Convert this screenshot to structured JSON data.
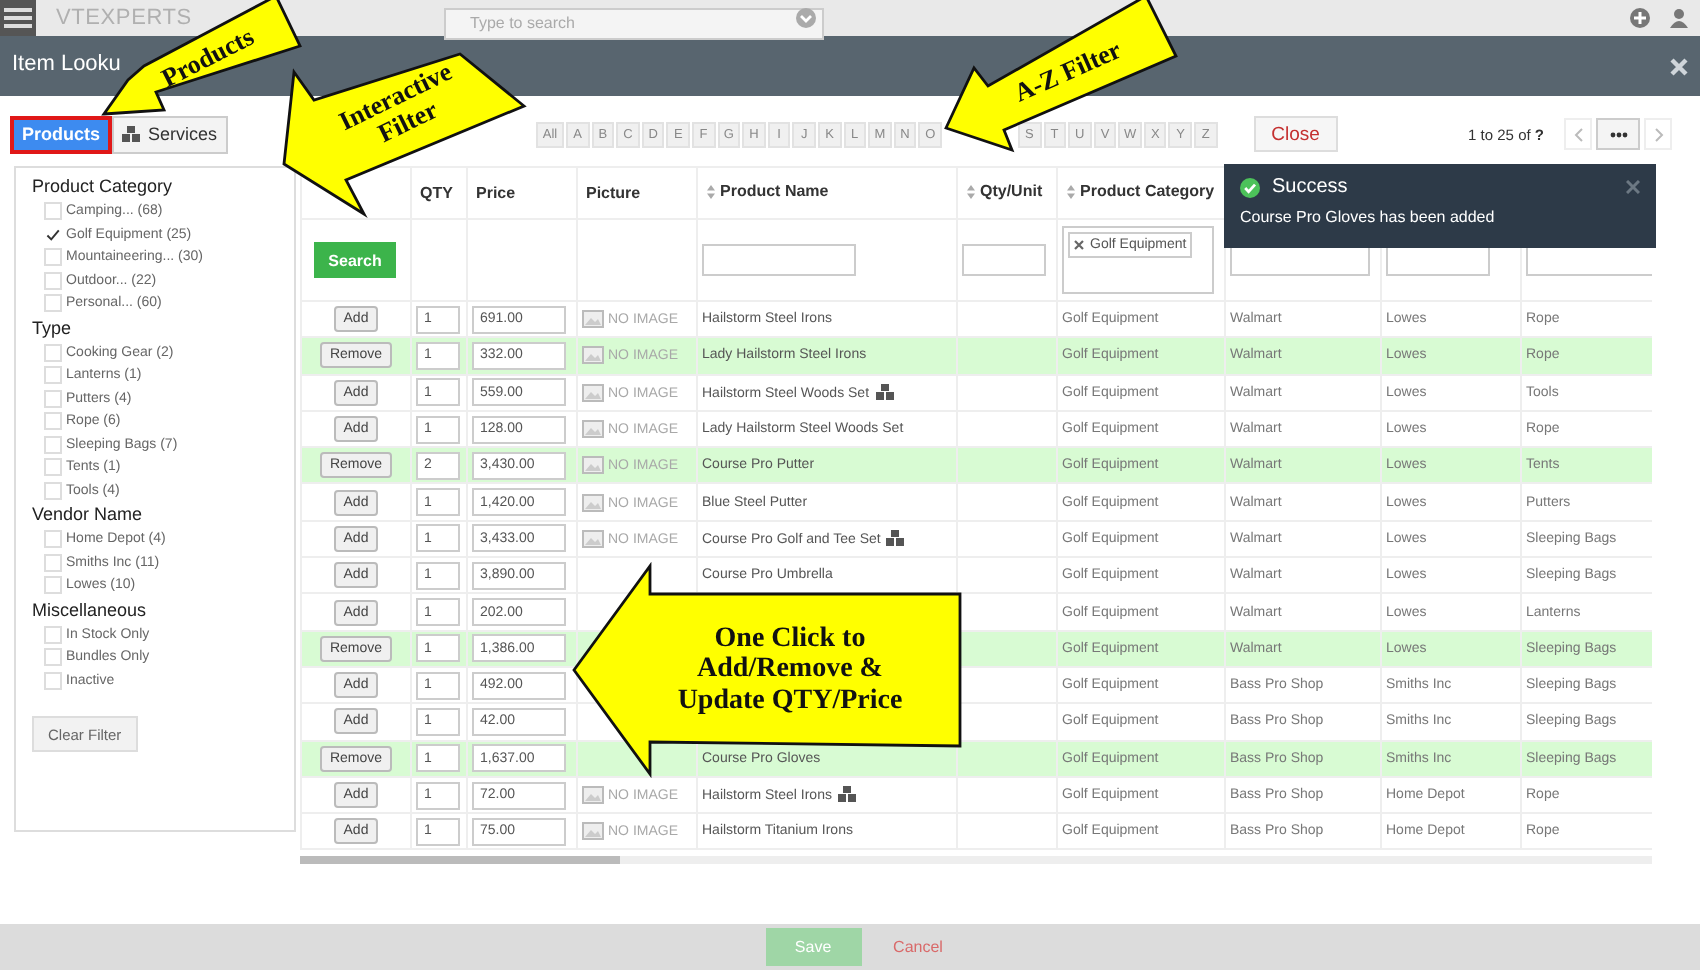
{
  "page_header": {
    "logo": "VTEXPERTS",
    "search": {
      "placeholder": "Type to search"
    }
  },
  "modal": {
    "title": "Item Looku"
  },
  "tabs": [
    {
      "label": "Products",
      "selected": true
    },
    {
      "label": "Services",
      "selected": false
    }
  ],
  "filters": [
    {
      "title": "Product Category",
      "options": [
        {
          "label": "Camping... (68)",
          "checked": false
        },
        {
          "label": "Golf Equipment (25)",
          "checked": true
        },
        {
          "label": "Mountaineering... (30)",
          "checked": false
        },
        {
          "label": "Outdoor... (22)",
          "checked": false
        },
        {
          "label": "Personal... (60)",
          "checked": false
        }
      ]
    },
    {
      "title": "Type",
      "options": [
        {
          "label": "Cooking Gear (2)",
          "checked": false
        },
        {
          "label": "Lanterns (1)",
          "checked": false
        },
        {
          "label": "Putters (4)",
          "checked": false
        },
        {
          "label": "Rope (6)",
          "checked": false
        },
        {
          "label": "Sleeping Bags (7)",
          "checked": false
        },
        {
          "label": "Tents (1)",
          "checked": false
        },
        {
          "label": "Tools (4)",
          "checked": false
        }
      ]
    },
    {
      "title": "Vendor Name",
      "options": [
        {
          "label": "Home Depot (4)",
          "checked": false
        },
        {
          "label": "Smiths Inc (11)",
          "checked": false
        },
        {
          "label": "Lowes (10)",
          "checked": false
        }
      ]
    },
    {
      "title": "Miscellaneous",
      "options": [
        {
          "label": "In Stock Only",
          "checked": false
        },
        {
          "label": "Bundles Only",
          "checked": false
        },
        {
          "label": "Inactive",
          "checked": false
        }
      ]
    }
  ],
  "clear_filter": "Clear Filter",
  "alphabet": {
    "before_callout": [
      "All",
      "A",
      "B",
      "C",
      "D",
      "E",
      "F",
      "G",
      "H",
      "I",
      "J",
      "K",
      "L",
      "M",
      "N",
      "O"
    ],
    "after_callout": [
      "S",
      "T",
      "U",
      "V",
      "W",
      "X",
      "Y",
      "Z"
    ]
  },
  "close_button": "Close",
  "pagination": {
    "range": "1 to 25  of **?**"
  },
  "table": {
    "columns": [
      {
        "label": "QTY",
        "sortable": false
      },
      {
        "label": "Price",
        "sortable": false
      },
      {
        "label": "Picture",
        "sortable": false
      },
      {
        "label": "Product Name",
        "sortable": true
      },
      {
        "label": "Qty/Unit",
        "sortable": true
      },
      {
        "label": "Product Category",
        "sortable": true
      }
    ],
    "search_button": "Search",
    "category_filter_tag": "Golf Equipment",
    "rows": [
      {
        "action": "Add",
        "selected": false,
        "qty": "1",
        "price": "691.00",
        "picture": "NO IMAGE",
        "product_name": "Hailstorm Steel Irons",
        "bundle": false,
        "product_category": "Golf Equipment",
        "column_7": "Walmart",
        "column_8": "Lowes",
        "column_9": "Rope"
      },
      {
        "action": "Remove",
        "selected": true,
        "qty": "1",
        "price": "332.00",
        "picture": "NO IMAGE",
        "product_name": "Lady Hailstorm Steel Irons",
        "bundle": false,
        "product_category": "Golf Equipment",
        "column_7": "Walmart",
        "column_8": "Lowes",
        "column_9": "Rope"
      },
      {
        "action": "Add",
        "selected": false,
        "qty": "1",
        "price": "559.00",
        "picture": "NO IMAGE",
        "product_name": "Hailstorm Steel Woods Set",
        "bundle": true,
        "product_category": "Golf Equipment",
        "column_7": "Walmart",
        "column_8": "Lowes",
        "column_9": "Tools"
      },
      {
        "action": "Add",
        "selected": false,
        "qty": "1",
        "price": "128.00",
        "picture": "NO IMAGE",
        "product_name": "Lady Hailstorm Steel Woods Set",
        "bundle": false,
        "product_category": "Golf Equipment",
        "column_7": "Walmart",
        "column_8": "Lowes",
        "column_9": "Rope"
      },
      {
        "action": "Remove",
        "selected": true,
        "qty": "2",
        "price": "3,430.00",
        "picture": "NO IMAGE",
        "product_name": "Course Pro Putter",
        "bundle": false,
        "product_category": "Golf Equipment",
        "column_7": "Walmart",
        "column_8": "Lowes",
        "column_9": "Tents"
      },
      {
        "action": "Add",
        "selected": false,
        "qty": "1",
        "price": "1,420.00",
        "picture": "NO IMAGE",
        "product_name": "Blue Steel Putter",
        "bundle": false,
        "product_category": "Golf Equipment",
        "column_7": "Walmart",
        "column_8": "Lowes",
        "column_9": "Putters"
      },
      {
        "action": "Add",
        "selected": false,
        "qty": "1",
        "price": "3,433.00",
        "picture": "NO IMAGE",
        "product_name": "Course Pro Golf and Tee Set",
        "bundle": true,
        "product_category": "Golf Equipment",
        "column_7": "Walmart",
        "column_8": "Lowes",
        "column_9": "Sleeping Bags"
      },
      {
        "action": "Add",
        "selected": false,
        "qty": "1",
        "price": "3,890.00",
        "product_name": "Course Pro Umbrella",
        "bundle": false,
        "product_category": "Golf Equipment",
        "column_7": "Walmart",
        "column_8": "Lowes",
        "column_9": "Sleeping Bags"
      },
      {
        "action": "Add",
        "selected": false,
        "qty": "1",
        "price": "202.00",
        "product_category": "Golf Equipment",
        "column_7": "Walmart",
        "column_8": "Lowes",
        "column_9": "Lanterns"
      },
      {
        "action": "Remove",
        "selected": true,
        "qty": "1",
        "price": "1,386.00",
        "product_category": "Golf Equipment",
        "column_7": "Walmart",
        "column_8": "Lowes",
        "column_9": "Sleeping Bags"
      },
      {
        "action": "Add",
        "selected": false,
        "qty": "1",
        "price": "492.00",
        "product_category": "Golf Equipment",
        "column_7": "Bass Pro Shop",
        "column_8": "Smiths Inc",
        "column_9": "Sleeping Bags"
      },
      {
        "action": "Add",
        "selected": false,
        "qty": "1",
        "price": "42.00",
        "product_category": "Golf Equipment",
        "column_7": "Bass Pro Shop",
        "column_8": "Smiths Inc",
        "column_9": "Sleeping Bags"
      },
      {
        "action": "Remove",
        "selected": true,
        "qty": "1",
        "price": "1,637.00",
        "product_name": "Course Pro Gloves",
        "bundle": false,
        "product_category": "Golf Equipment",
        "column_7": "Bass Pro Shop",
        "column_8": "Smiths Inc",
        "column_9": "Sleeping Bags"
      },
      {
        "action": "Add",
        "selected": false,
        "qty": "1",
        "price": "72.00",
        "picture": "NO IMAGE",
        "product_name": "Hailstorm Steel Irons",
        "bundle": true,
        "product_category": "Golf Equipment",
        "column_7": "Bass Pro Shop",
        "column_8": "Home Depot",
        "column_9": "Rope"
      },
      {
        "action": "Add",
        "selected": false,
        "qty": "1",
        "price": "75.00",
        "picture": "NO IMAGE",
        "product_name": "Hailstorm Titanium Irons",
        "bundle": false,
        "product_category": "Golf Equipment",
        "column_7": "Bass Pro Shop",
        "column_8": "Home Depot",
        "column_9": "Rope"
      }
    ]
  },
  "toast": {
    "title": "Success",
    "message": "Course Pro Gloves has been added"
  },
  "footer": {
    "save": "Save",
    "cancel": "Cancel"
  },
  "callouts": [
    {
      "lines": [
        "Products"
      ]
    },
    {
      "lines": [
        "Interactive",
        "Filter"
      ]
    },
    {
      "lines": [
        "A-Z Filter"
      ]
    },
    {
      "lines": [
        "One Click to",
        "Add/Remove &",
        "Update QTY/Price"
      ]
    }
  ]
}
